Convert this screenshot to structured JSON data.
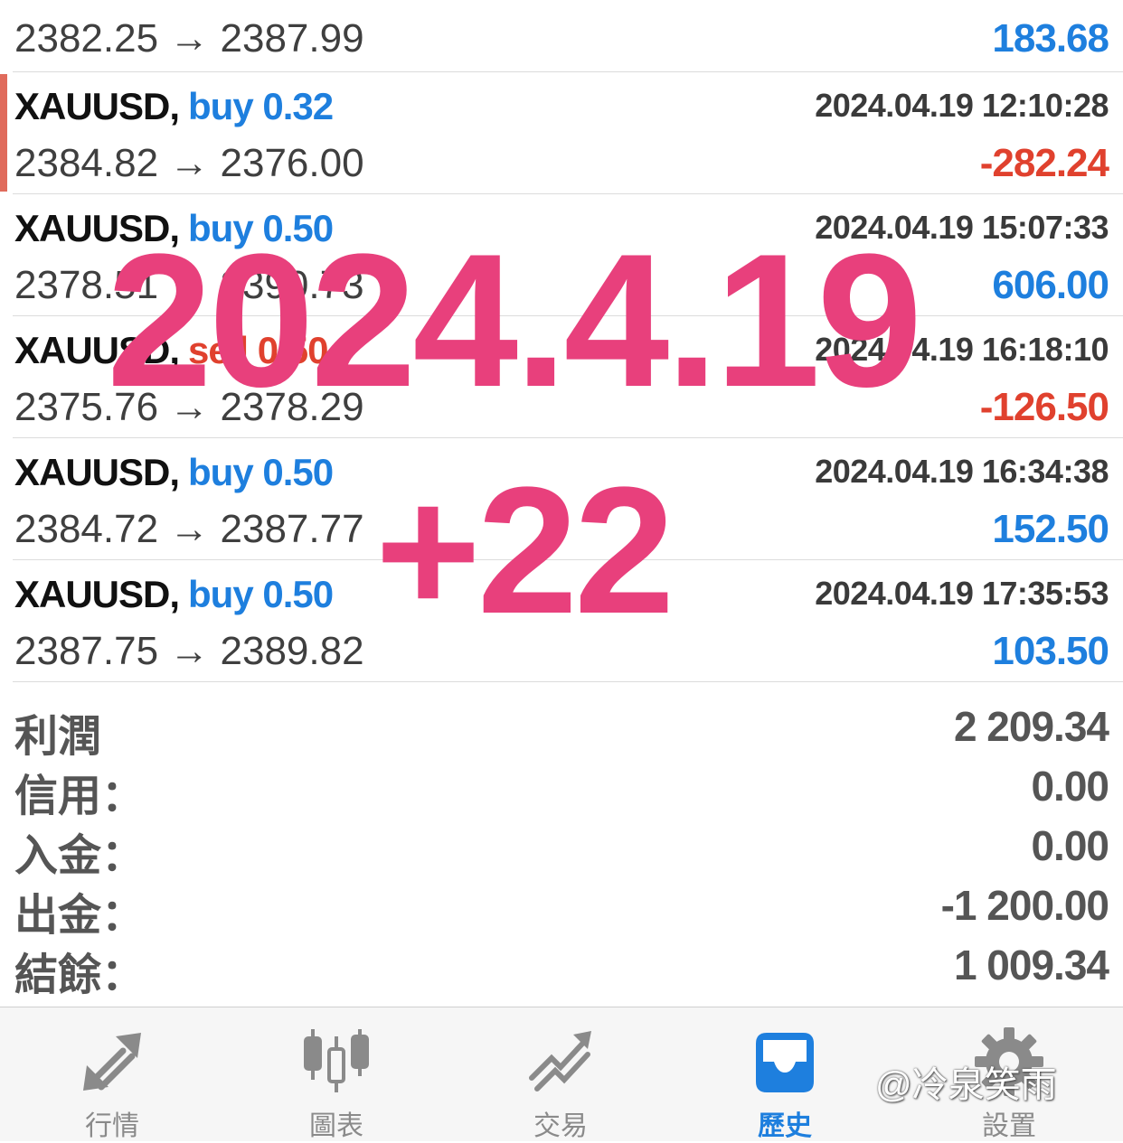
{
  "deals": [
    {
      "prices": "2382.25 → 2387.99",
      "profit": "183.68",
      "profit_sign": "pos"
    },
    {
      "symbol": "XAUUSD,",
      "side": "buy",
      "volume": "0.32",
      "time": "2024.04.19 12:10:28",
      "prices": "2384.82 → 2376.00",
      "profit": "-282.24",
      "profit_sign": "neg"
    },
    {
      "symbol": "XAUUSD,",
      "side": "buy",
      "volume": "0.50",
      "time": "2024.04.19 15:07:33",
      "prices": "2378.51 → 2390.73",
      "profit": "606.00",
      "profit_sign": "pos"
    },
    {
      "symbol": "XAUUSD,",
      "side": "sell",
      "volume": "0.50",
      "time": "2024.04.19 16:18:10",
      "prices": "2375.76 → 2378.29",
      "profit": "-126.50",
      "profit_sign": "neg"
    },
    {
      "symbol": "XAUUSD,",
      "side": "buy",
      "volume": "0.50",
      "time": "2024.04.19 16:34:38",
      "prices": "2384.72 → 2387.77",
      "profit": "152.50",
      "profit_sign": "pos"
    },
    {
      "symbol": "XAUUSD,",
      "side": "buy",
      "volume": "0.50",
      "time": "2024.04.19 17:35:53",
      "prices": "2387.75 → 2389.82",
      "profit": "103.50",
      "profit_sign": "pos"
    }
  ],
  "summary": [
    {
      "label": "利潤",
      "value": "2 209.34"
    },
    {
      "label": "信用：",
      "value": "0.00"
    },
    {
      "label": "入金：",
      "value": "0.00"
    },
    {
      "label": "出金：",
      "value": "-1 200.00"
    },
    {
      "label": "結餘：",
      "value": "1 009.34"
    }
  ],
  "overlay": {
    "date": "2024.4.19",
    "gain": "+22"
  },
  "tabs": [
    {
      "label": "行情",
      "icon": "quotes-arrows-icon"
    },
    {
      "label": "圖表",
      "icon": "candlestick-chart-icon"
    },
    {
      "label": "交易",
      "icon": "trade-trend-icon"
    },
    {
      "label": "歷史",
      "icon": "history-inbox-icon",
      "active": true
    },
    {
      "label": "設置",
      "icon": "settings-gear-icon"
    }
  ],
  "watermark": "@冷泉笑雨",
  "colors": {
    "buy": "#1e7fde",
    "sell": "#e0412e",
    "overlay": "#e8407c",
    "active_tab": "#1e7fde"
  }
}
